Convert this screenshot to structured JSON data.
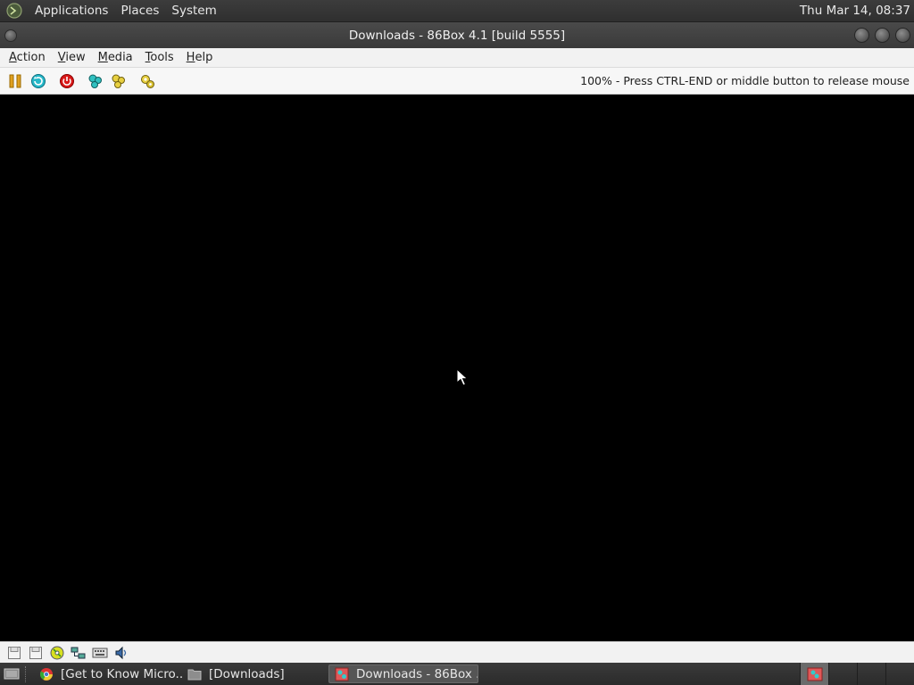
{
  "top_panel": {
    "menus": [
      "Applications",
      "Places",
      "System"
    ],
    "clock": "Thu Mar 14, 08:37"
  },
  "window": {
    "title": "Downloads - 86Box 4.1 [build 5555]"
  },
  "menubar": {
    "items": [
      {
        "label": "Action",
        "mnemonic": "A"
      },
      {
        "label": "View",
        "mnemonic": "V"
      },
      {
        "label": "Media",
        "mnemonic": "M"
      },
      {
        "label": "Tools",
        "mnemonic": "T"
      },
      {
        "label": "Help",
        "mnemonic": "H"
      }
    ]
  },
  "toolbar": {
    "buttons": [
      "pause-icon",
      "reset-icon",
      "power-icon",
      "ctrl-alt-del-icon",
      "ctrl-alt-esc-icon",
      "settings-icon"
    ],
    "status_message": "100% - Press CTRL-END or middle button to release mouse"
  },
  "statusbar": {
    "icons": [
      "floppy-drive-1-icon",
      "floppy-drive-2-icon",
      "cdrom-icon",
      "network-icon",
      "keyboard-icon",
      "sound-icon"
    ]
  },
  "taskbar": {
    "tasks": [
      {
        "label": "[Get to Know Micro...",
        "icon": "chrome-icon",
        "active": false
      },
      {
        "label": "[Downloads]",
        "icon": "folder-icon",
        "active": false
      },
      {
        "label": "Downloads - 86Box ...",
        "icon": "86box-icon",
        "active": true
      }
    ]
  },
  "colors": {
    "panel": "#333333",
    "screen": "#000000",
    "menubar": "#f2f2f2"
  }
}
